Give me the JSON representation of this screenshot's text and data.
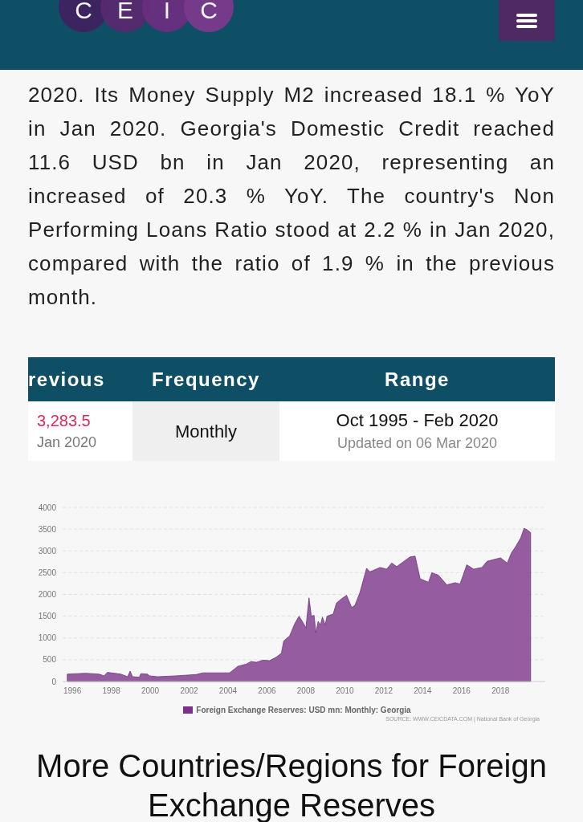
{
  "header": {
    "logo_letters": [
      "C",
      "E",
      "I",
      "C"
    ]
  },
  "summary": "2020. Its Money Supply M2 increased 18.1 % YoY in Jan 2020. Georgia's Domestic Credit reached 11.6 USD bn in Jan 2020, representing an increased of 20.3 % YoY. The country's Non Performing Loans Ratio stood at 2.2 % in Jan 2020, compared with the ratio of 1.9 % in the previous month.",
  "table": {
    "columns": [
      "revious",
      "Frequency",
      "Range"
    ],
    "row": {
      "previous_value": "3,283.5",
      "previous_date": "Jan 2020",
      "frequency": "Monthly",
      "range": "Oct 1995 - Feb 2020",
      "updated": "Updated on 06 Mar 2020"
    }
  },
  "chart": {
    "chart_data": {
      "type": "area",
      "grid": true,
      "xlim": [
        1995.5,
        2020.3
      ],
      "ylim": [
        0,
        4000
      ],
      "xticks": [
        1996,
        1998,
        2000,
        2002,
        2004,
        2006,
        2008,
        2010,
        2012,
        2014,
        2016,
        2018
      ],
      "yticks": [
        0,
        500,
        1000,
        1500,
        2000,
        2500,
        3000,
        3500,
        4000
      ],
      "x": [
        1995.74,
        1996.69,
        1997.37,
        1997.63,
        1997.8,
        1998.49,
        1998.84,
        1998.97,
        1999.09,
        1999.44,
        1999.52,
        1999.87,
        1999.95,
        2000.38,
        2001.33,
        2002.36,
        2002.7,
        2004.08,
        2004.51,
        2004.94,
        2005.19,
        2005.45,
        2005.79,
        2006.14,
        2006.48,
        2006.74,
        2006.86,
        2007.17,
        2007.43,
        2007.65,
        2007.86,
        2008.0,
        2008.16,
        2008.28,
        2008.42,
        2008.51,
        2008.63,
        2008.75,
        2008.85,
        2008.99,
        2009.09,
        2009.4,
        2009.57,
        2009.83,
        2010.09,
        2010.35,
        2010.52,
        2010.78,
        2011.12,
        2011.29,
        2011.81,
        2012.15,
        2012.41,
        2012.67,
        2013.01,
        2013.35,
        2013.61,
        2013.87,
        2014.3,
        2014.47,
        2014.81,
        2015.24,
        2015.67,
        2015.92,
        2016.27,
        2016.62,
        2017.05,
        2017.31,
        2017.65,
        2018.0,
        2018.35,
        2018.56,
        2018.78,
        2019.04,
        2019.21,
        2019.38,
        2019.55
      ],
      "series": [
        {
          "name": "Foreign Exchange Reserves: USD mn: Monthly: Georgia",
          "color": "#955c9f",
          "values": [
            170,
            190,
            170,
            130,
            210,
            170,
            110,
            240,
            110,
            100,
            180,
            170,
            130,
            110,
            130,
            160,
            200,
            200,
            350,
            400,
            460,
            440,
            490,
            480,
            560,
            650,
            930,
            1050,
            1330,
            1500,
            1350,
            1230,
            1920,
            1500,
            1520,
            1120,
            1380,
            1300,
            1480,
            1300,
            1500,
            1550,
            1800,
            1900,
            1980,
            1700,
            1750,
            2050,
            2600,
            2520,
            2620,
            2580,
            2720,
            2640,
            2750,
            2860,
            2880,
            2360,
            2280,
            2500,
            2440,
            2220,
            2270,
            2240,
            2680,
            2580,
            2620,
            2760,
            2800,
            2840,
            2720,
            2950,
            3100,
            3300,
            3520,
            3480,
            3420
          ]
        }
      ]
    },
    "source": "SOURCE: WWW.CEICDATA.COM | National Bank of Georgia"
  },
  "more_heading": "More Countries/Regions for Foreign Exchange Reserves"
}
